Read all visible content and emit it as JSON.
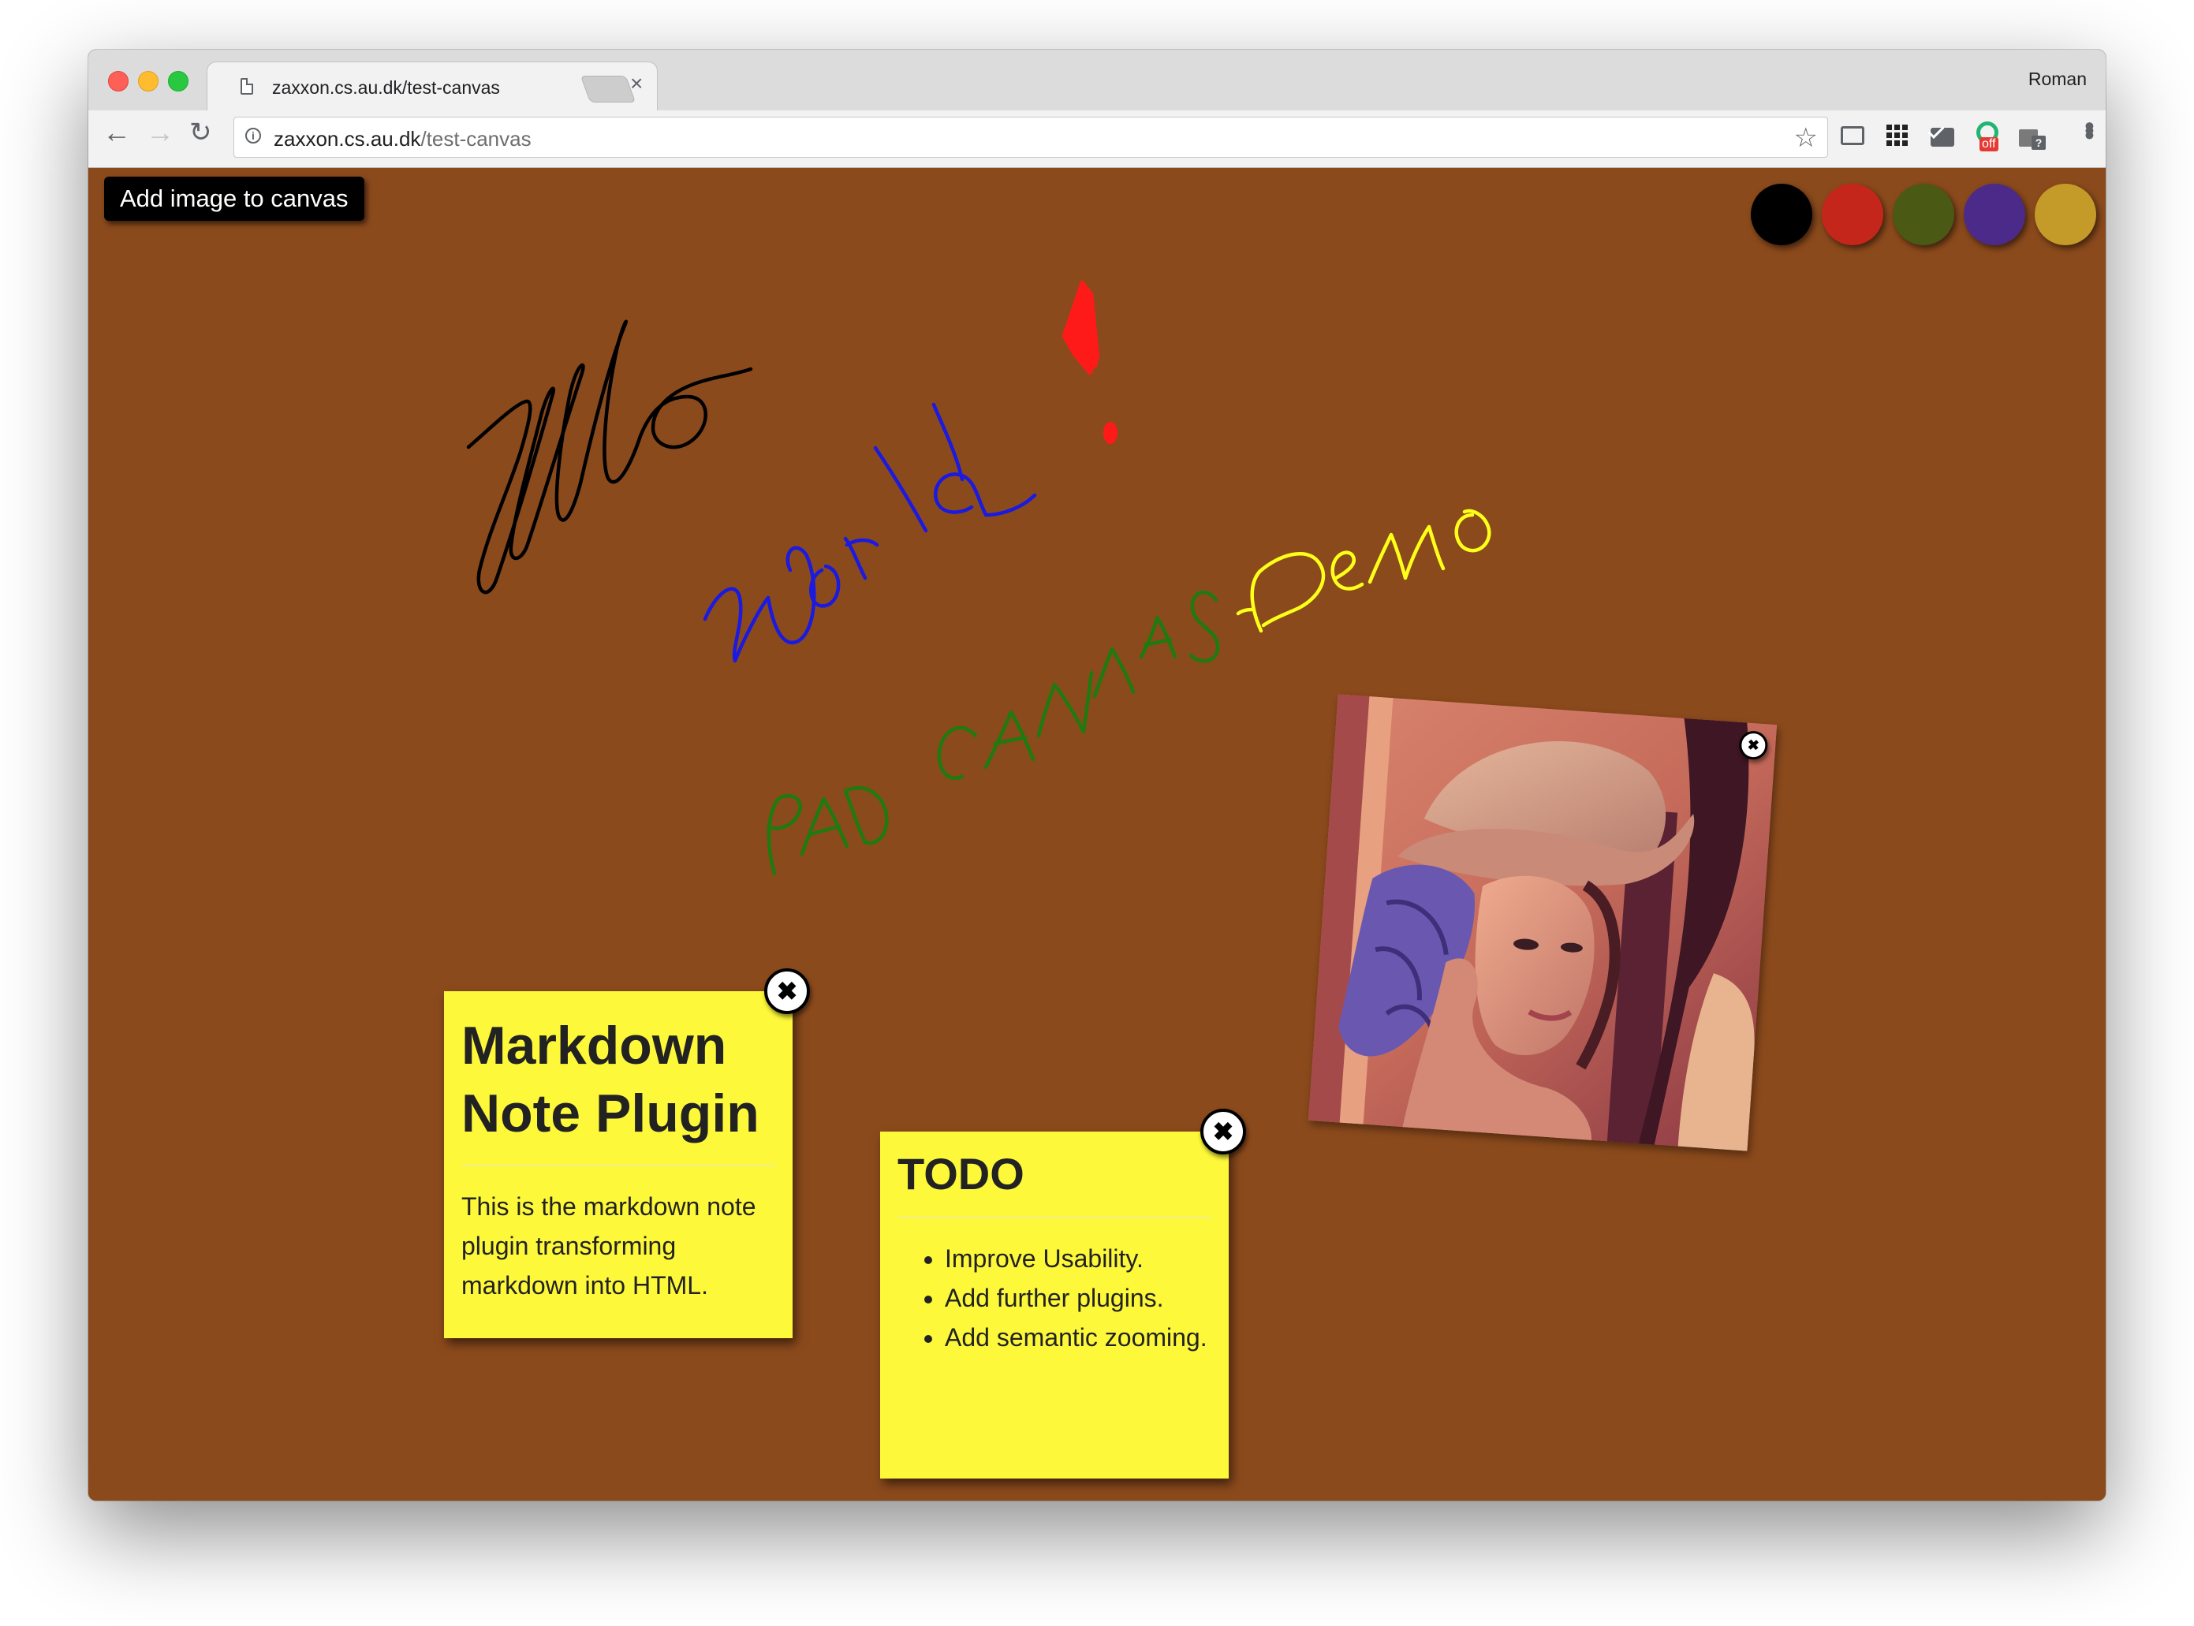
{
  "browser": {
    "tab_title": "zaxxon.cs.au.dk/test-canvas",
    "tab_close": "×",
    "profile_name": "Roman",
    "url_host": "zaxxon.cs.au.dk",
    "url_path": "/test-canvas",
    "info_glyph": "i",
    "star_glyph": "☆",
    "back_glyph": "←",
    "forward_glyph": "→",
    "reload_glyph": "↻",
    "menu_glyph": "•••",
    "ext_off_badge": "off",
    "ext_gift_badge": "?"
  },
  "toolbar": {
    "add_image_label": "Add image to canvas"
  },
  "palette": [
    {
      "name": "black",
      "color": "#000000"
    },
    {
      "name": "red",
      "color": "#c4261b"
    },
    {
      "name": "green",
      "color": "#4a5a14"
    },
    {
      "name": "purple",
      "color": "#4c2a8a"
    },
    {
      "name": "gold",
      "color": "#c49a28"
    }
  ],
  "ink_colors": {
    "black": "#000000",
    "blue": "#1a1ae0",
    "red": "#ff1a1a",
    "green": "#1f7a10",
    "yellow": "#ffff1a"
  },
  "notes": [
    {
      "title": "Markdown Note Plugin",
      "body": "This is the markdown note plugin transforming markdown into HTML.",
      "close_glyph": "✖"
    },
    {
      "title": "TODO",
      "items": [
        "Improve Usability.",
        "Add further plugins.",
        "Add semantic zooming."
      ],
      "close_glyph": "✖"
    }
  ],
  "image": {
    "close_glyph": "✖"
  }
}
